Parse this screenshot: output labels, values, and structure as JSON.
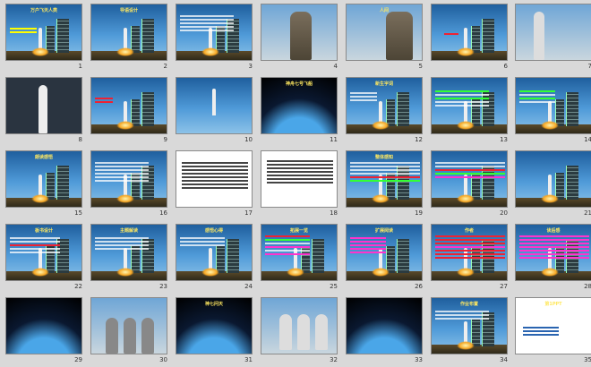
{
  "slides": [
    {
      "num": "1",
      "title": "万户飞天人类"
    },
    {
      "num": "2",
      "title": "导语设计"
    },
    {
      "num": "3",
      "title": ""
    },
    {
      "num": "4",
      "title": ""
    },
    {
      "num": "5",
      "title": "人间"
    },
    {
      "num": "6",
      "title": ""
    },
    {
      "num": "7",
      "title": ""
    },
    {
      "num": "8",
      "title": ""
    },
    {
      "num": "9",
      "title": ""
    },
    {
      "num": "10",
      "title": ""
    },
    {
      "num": "11",
      "title": "神舟七号飞船"
    },
    {
      "num": "12",
      "title": "新生字词"
    },
    {
      "num": "13",
      "title": ""
    },
    {
      "num": "14",
      "title": ""
    },
    {
      "num": "15",
      "title": "朗读感悟"
    },
    {
      "num": "16",
      "title": ""
    },
    {
      "num": "17",
      "title": ""
    },
    {
      "num": "18",
      "title": ""
    },
    {
      "num": "19",
      "title": "整体感知"
    },
    {
      "num": "20",
      "title": ""
    },
    {
      "num": "21",
      "title": ""
    },
    {
      "num": "22",
      "title": "板书设计"
    },
    {
      "num": "23",
      "title": "主题解读"
    },
    {
      "num": "24",
      "title": "感悟心得"
    },
    {
      "num": "25",
      "title": "拓展一览"
    },
    {
      "num": "26",
      "title": "扩展阅读"
    },
    {
      "num": "27",
      "title": "作者"
    },
    {
      "num": "28",
      "title": "读后感"
    },
    {
      "num": "29",
      "title": ""
    },
    {
      "num": "30",
      "title": ""
    },
    {
      "num": "31",
      "title": "神七问天"
    },
    {
      "num": "32",
      "title": ""
    },
    {
      "num": "33",
      "title": ""
    },
    {
      "num": "34",
      "title": "作业布置"
    },
    {
      "num": "35",
      "title": "第1PPT"
    }
  ],
  "colors": {
    "background": "#d9d9d9",
    "sky": "#3a86c8",
    "title": "#ffe860"
  }
}
